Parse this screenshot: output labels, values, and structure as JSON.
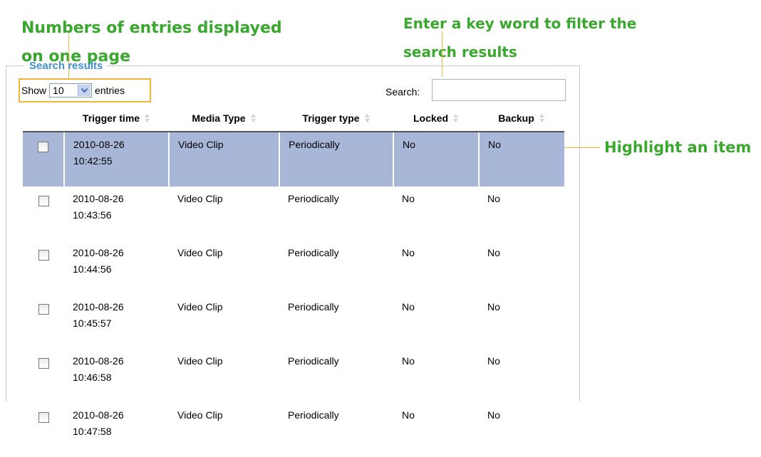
{
  "callouts": {
    "entries": [
      "Numbers of entries displayed",
      "on one page"
    ],
    "search": [
      "Enter a key word to filter the",
      "search results"
    ],
    "highlight": "Highlight an item"
  },
  "panel": {
    "legend": "Search results"
  },
  "show": {
    "prefix": "Show",
    "value": "10",
    "suffix": "entries"
  },
  "search": {
    "label": "Search:",
    "value": ""
  },
  "table": {
    "headers": [
      "Trigger time",
      "Media Type",
      "Trigger type",
      "Locked",
      "Backup"
    ],
    "rows": [
      {
        "date": "2010-08-26",
        "time": "10:42:55",
        "media": "Video Clip",
        "trigger": "Periodically",
        "locked": "No",
        "backup": "No"
      },
      {
        "date": "2010-08-26",
        "time": "10:43:56",
        "media": "Video Clip",
        "trigger": "Periodically",
        "locked": "No",
        "backup": "No"
      },
      {
        "date": "2010-08-26",
        "time": "10:44:56",
        "media": "Video Clip",
        "trigger": "Periodically",
        "locked": "No",
        "backup": "No"
      },
      {
        "date": "2010-08-26",
        "time": "10:45:57",
        "media": "Video Clip",
        "trigger": "Periodically",
        "locked": "No",
        "backup": "No"
      },
      {
        "date": "2010-08-26",
        "time": "10:46:58",
        "media": "Video Clip",
        "trigger": "Periodically",
        "locked": "No",
        "backup": "No"
      },
      {
        "date": "2010-08-26",
        "time": "10:47:58",
        "media": "Video Clip",
        "trigger": "Periodically",
        "locked": "No",
        "backup": "No"
      }
    ]
  },
  "colors": {
    "callout": "#3aa82e",
    "leader": "#f0b63a",
    "highlight_row": "#a8b6d8",
    "legend": "#3f8fd6"
  }
}
